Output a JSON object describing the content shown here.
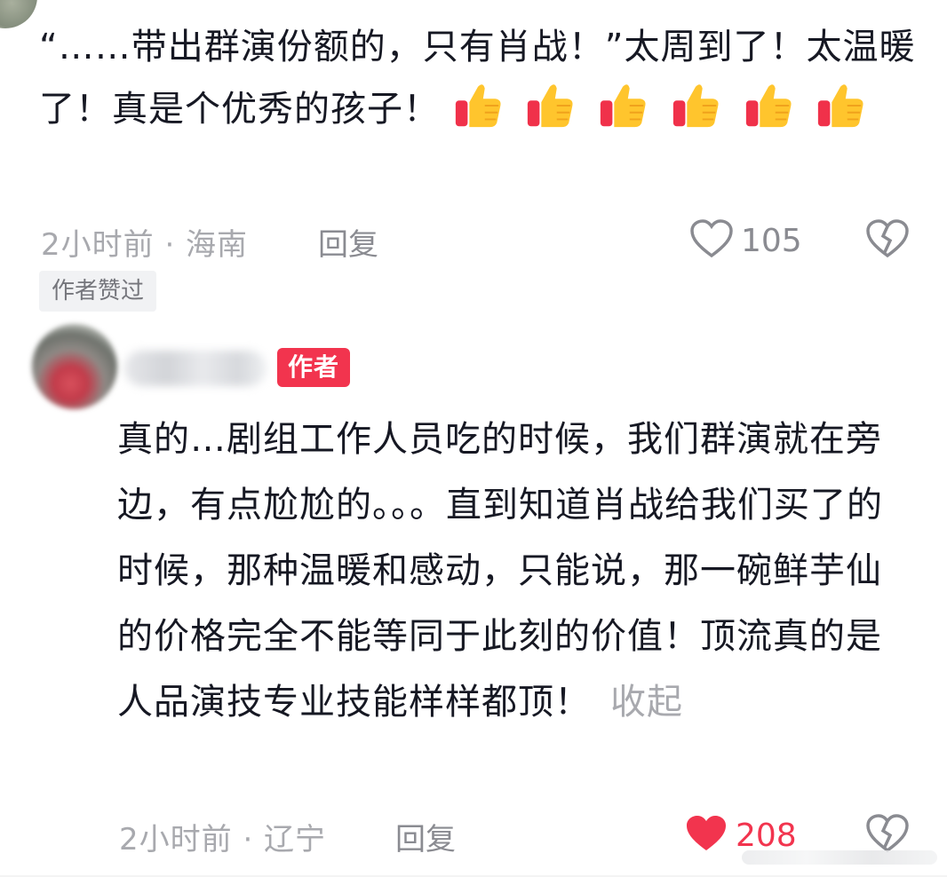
{
  "comment1": {
    "text": "“……带出群演份额的，只有肖战！”太周到了！太温暖了！真是个优秀的孩子！",
    "emoji": [
      "thumbs-up-icon",
      "thumbs-up-icon",
      "thumbs-up-icon",
      "thumbs-up-icon",
      "thumbs-up-icon",
      "thumbs-up-icon"
    ],
    "meta": "2小时前 · 海南",
    "reply_label": "回复",
    "like_count": "105",
    "liked": false,
    "author_liked_label": "作者赞过"
  },
  "comment2": {
    "author_badge": "作者",
    "text": "真的…剧组工作人员吃的时候，我们群演就在旁边，有点尬尬的。。。直到知道肖战给我们买了的时候，那种温暖和感动，只能说，那一碗鲜芋仙的价格完全不能等同于此刻的价值！顶流真的是人品演技专业技能样样都顶！",
    "collapse_label": "收起",
    "meta": "2小时前 · 辽宁",
    "reply_label": "回复",
    "like_count": "208",
    "liked": true
  },
  "colors": {
    "accent": "#f2344e",
    "muted": "#a8a9ae",
    "text": "#161823"
  }
}
